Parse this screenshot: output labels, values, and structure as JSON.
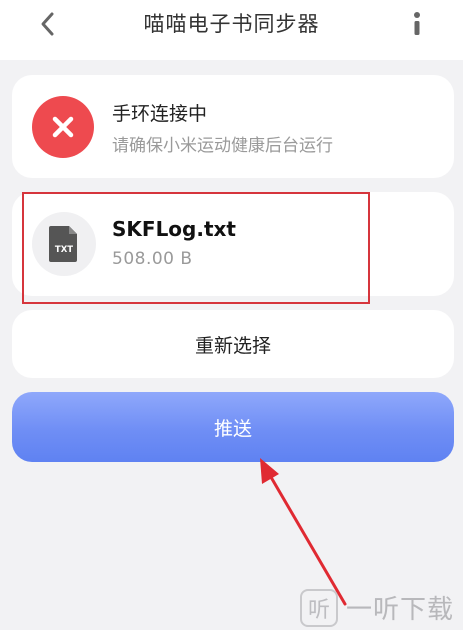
{
  "header": {
    "title": "喵喵电子书同步器",
    "back_icon": "chevron-left-icon",
    "more_icon": "vertical-info-icon"
  },
  "status": {
    "title": "手环连接中",
    "subtitle": "请确保小米运动健康后台运行",
    "icon": "close-x-icon",
    "color": "#ee4a4f"
  },
  "file": {
    "name": "SKFLog.txt",
    "size": "508.00 B",
    "icon": "txt-file-icon",
    "icon_label": "TXT"
  },
  "actions": {
    "reselect_label": "重新选择",
    "push_label": "推送"
  },
  "annotation": {
    "highlight_color": "#d6353c"
  },
  "watermark": {
    "logo": "听",
    "text": "一听下载"
  }
}
